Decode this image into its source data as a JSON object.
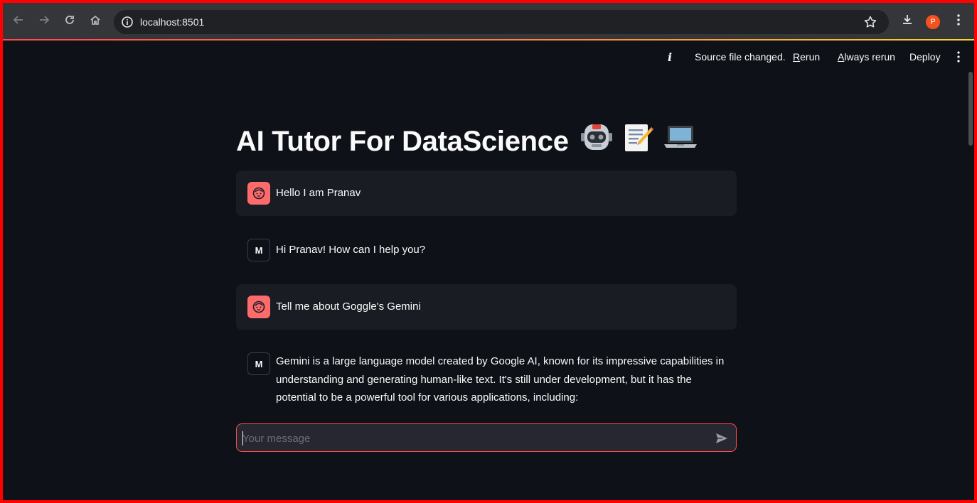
{
  "browser": {
    "url": "localhost:8501",
    "profile_initial": "P"
  },
  "toolbar": {
    "status_text": "Source file changed.",
    "rerun_hotkey": "R",
    "rerun_rest": "erun",
    "always_hotkey": "A",
    "always_rest": "lways rerun",
    "deploy_label": "Deploy"
  },
  "page": {
    "title": "AI Tutor For DataScience",
    "title_emojis": [
      "robot-icon",
      "memo-icon",
      "laptop-icon"
    ]
  },
  "messages": [
    {
      "role": "user",
      "avatar_icon": "user-face-icon",
      "text": "Hello I am Pranav"
    },
    {
      "role": "model",
      "avatar_label": "M",
      "text": "Hi Pranav! How can I help you?"
    },
    {
      "role": "user",
      "avatar_icon": "user-face-icon",
      "text": "Tell me about Goggle's Gemini"
    },
    {
      "role": "model",
      "avatar_label": "M",
      "lines": [
        "Gemini is a large language model created by Google AI, known for its impressive capabilities in",
        "understanding and generating human-like text. It's still under development, but it has the",
        "potential to be a powerful tool for various applications, including:"
      ]
    }
  ],
  "chat_input": {
    "placeholder": "Your message"
  },
  "colors": {
    "accent": "#ff4b4b",
    "background": "#0e1117",
    "user_bubble": "#1a1c24",
    "user_avatar": "#ff6b6b"
  }
}
